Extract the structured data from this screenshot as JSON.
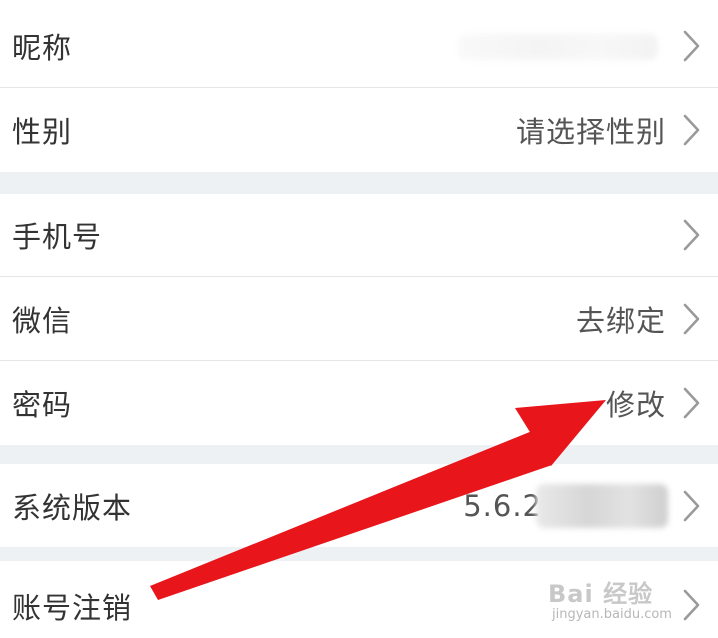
{
  "rows": {
    "nickname": {
      "label": "昵称",
      "value": ""
    },
    "gender": {
      "label": "性别",
      "value": "请选择性别"
    },
    "phone": {
      "label": "手机号",
      "value": ""
    },
    "wechat": {
      "label": "微信",
      "value": "去绑定"
    },
    "password": {
      "label": "密码",
      "value": "修改"
    },
    "version": {
      "label": "系统版本",
      "value": "5.6.2"
    },
    "deregister": {
      "label": "账号注销",
      "value": ""
    }
  },
  "colors": {
    "annotation_arrow": "#e8151b",
    "section_gap": "#eef1f4",
    "row_background": "#ffffff"
  },
  "icons": {
    "row_chevron": "chevron-right-icon"
  },
  "watermark": {
    "logo": "Bai 经验",
    "url": "jingyan.baidu.com"
  }
}
